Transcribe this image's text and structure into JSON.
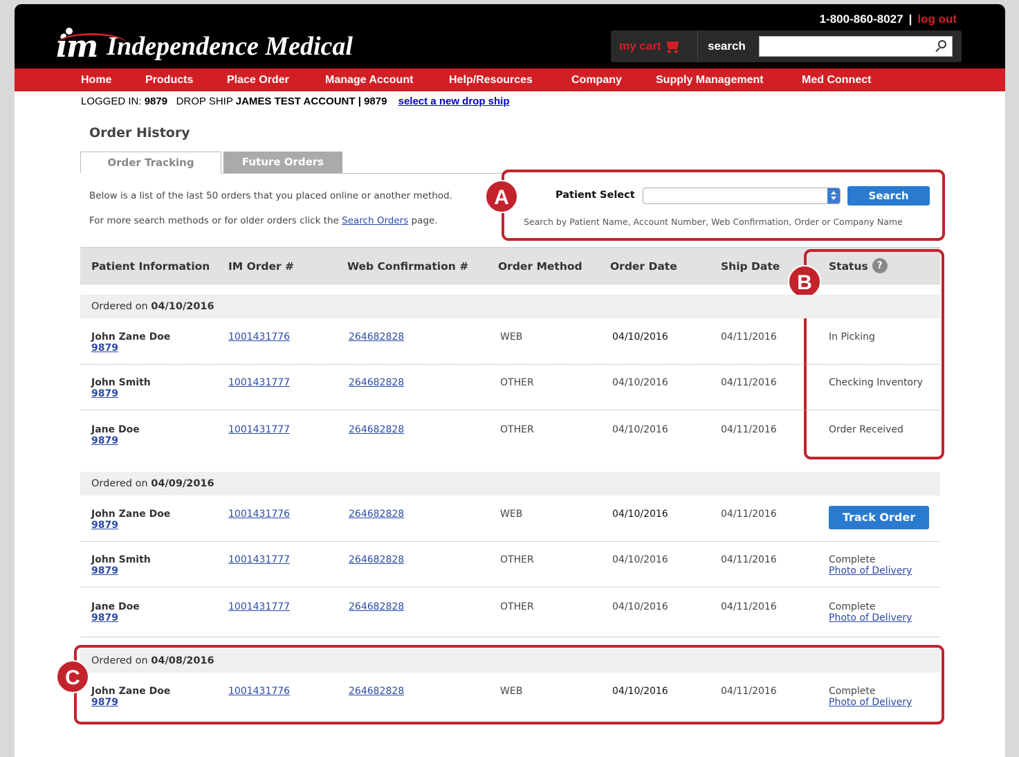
{
  "header": {
    "logo_mark": "im",
    "logo_text": "Independence Medical",
    "phone": "1-800-860-8027",
    "separator": "|",
    "logout": "log out",
    "cart_label": "my cart",
    "search_label": "search",
    "search_value": ""
  },
  "nav": [
    "Home",
    "Products",
    "Place Order",
    "Manage Account",
    "Help/Resources",
    "Company",
    "Supply Management",
    "Med Connect"
  ],
  "login": {
    "prefix": "LOGGED IN:",
    "account": "9879",
    "drop_ship_label": "DROP SHIP",
    "drop_ship_value": "JAMES TEST ACCOUNT | 9879",
    "change_link": "select a new drop ship"
  },
  "page": {
    "title": "Order History",
    "tabs": [
      "Order Tracking",
      "Future Orders"
    ],
    "desc1": "Below is a list of the last 50 orders that you placed online or another method.",
    "desc2_pre": "For more search methods or for older orders click the",
    "desc2_link": "Search Orders",
    "desc2_post": "page."
  },
  "patient_search": {
    "label": "Patient Select",
    "selected": "",
    "button": "Search",
    "hint": "Search by Patient Name, Account Number, Web Confirmation, Order or Company Name"
  },
  "callouts": [
    "A",
    "B",
    "C"
  ],
  "table": {
    "headers": [
      "Patient Information",
      "IM Order #",
      "Web Confirmation #",
      "Order Method",
      "Order Date",
      "Ship Date",
      "Status"
    ],
    "ordered_on_label": "Ordered on",
    "groups": [
      {
        "date": "04/10/2016",
        "rows": [
          {
            "name": "John Zane Doe",
            "acct": "9879",
            "im_order": "1001431776",
            "web_conf": "264682828",
            "method": "WEB",
            "order_date": "04/10/2016",
            "ship_date": "04/11/2016",
            "status": "In Picking",
            "status_link": ""
          },
          {
            "name": "John Smith",
            "acct": "9879",
            "im_order": "1001431777",
            "web_conf": "264682828",
            "method": "OTHER",
            "order_date": "04/10/2016",
            "ship_date": "04/11/2016",
            "status": "Checking Inventory",
            "status_link": ""
          },
          {
            "name": "Jane Doe",
            "acct": "9879",
            "im_order": "1001431777",
            "web_conf": "264682828",
            "method": "OTHER",
            "order_date": "04/10/2016",
            "ship_date": "04/11/2016",
            "status": "Order Received",
            "status_link": ""
          }
        ]
      },
      {
        "date": "04/09/2016",
        "rows": [
          {
            "name": "John Zane Doe",
            "acct": "9879",
            "im_order": "1001431776",
            "web_conf": "264682828",
            "method": "WEB",
            "order_date": "04/10/2016",
            "ship_date": "04/11/2016",
            "status": "",
            "status_link": "",
            "button": "Track Order"
          },
          {
            "name": "John Smith",
            "acct": "9879",
            "im_order": "1001431777",
            "web_conf": "264682828",
            "method": "OTHER",
            "order_date": "04/10/2016",
            "ship_date": "04/11/2016",
            "status": "Complete",
            "status_link": "Photo of Delivery"
          },
          {
            "name": "Jane Doe",
            "acct": "9879",
            "im_order": "1001431777",
            "web_conf": "264682828",
            "method": "OTHER",
            "order_date": "04/10/2016",
            "ship_date": "04/11/2016",
            "status": "Complete",
            "status_link": "Photo of Delivery"
          }
        ]
      },
      {
        "date": "04/08/2016",
        "rows": [
          {
            "name": "John Zane Doe",
            "acct": "9879",
            "im_order": "1001431776",
            "web_conf": "264682828",
            "method": "WEB",
            "order_date": "04/10/2016",
            "ship_date": "04/11/2016",
            "status": "Complete",
            "status_link": "Photo of Delivery"
          }
        ]
      }
    ]
  },
  "colors": {
    "brand_red": "#d21f26",
    "button_blue": "#2a7ad0",
    "callout_red": "#c3232d",
    "link_blue": "#2a4aa8"
  }
}
